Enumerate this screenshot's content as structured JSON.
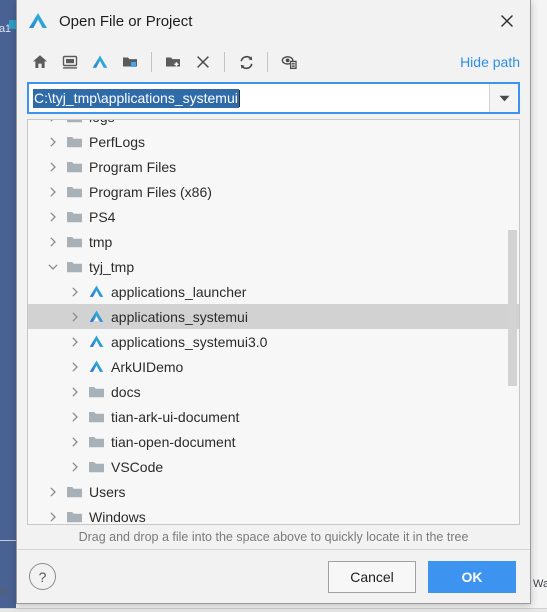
{
  "background": {
    "left_tab_label": "a1",
    "bottom_left_label": "W",
    "right_label": "Wa"
  },
  "dialog": {
    "title": "Open File or Project",
    "app_icon": "deveco-logo-icon",
    "close_label": "✕"
  },
  "toolbar": {
    "buttons": [
      {
        "name": "home-icon",
        "tooltip": "Home"
      },
      {
        "name": "desktop-icon",
        "tooltip": "Desktop"
      },
      {
        "name": "project-dir-icon",
        "tooltip": "Project Directory"
      },
      {
        "name": "recent-folder-icon",
        "tooltip": "Recent"
      },
      {
        "name": "new-folder-icon",
        "tooltip": "New Folder"
      },
      {
        "name": "delete-icon",
        "tooltip": "Delete"
      },
      {
        "name": "refresh-icon",
        "tooltip": "Refresh"
      },
      {
        "name": "show-hidden-icon",
        "tooltip": "Show Hidden Files"
      }
    ],
    "hide_path_label": "Hide path"
  },
  "path_field": {
    "value": "C:\\tyj_tmp\\applications_systemui",
    "placeholder": "",
    "selected": true,
    "dropdown_icon": "chevron-down-icon"
  },
  "tree": {
    "items": [
      {
        "label": "logs",
        "icon": "folder-icon",
        "indent": 1,
        "expanded": false,
        "selected": false,
        "partial": true
      },
      {
        "label": "PerfLogs",
        "icon": "folder-icon",
        "indent": 1,
        "expanded": false,
        "selected": false
      },
      {
        "label": "Program Files",
        "icon": "folder-icon",
        "indent": 1,
        "expanded": false,
        "selected": false
      },
      {
        "label": "Program Files (x86)",
        "icon": "folder-icon",
        "indent": 1,
        "expanded": false,
        "selected": false
      },
      {
        "label": "PS4",
        "icon": "folder-icon",
        "indent": 1,
        "expanded": false,
        "selected": false
      },
      {
        "label": "tmp",
        "icon": "folder-icon",
        "indent": 1,
        "expanded": false,
        "selected": false
      },
      {
        "label": "tyj_tmp",
        "icon": "folder-icon",
        "indent": 1,
        "expanded": true,
        "selected": false
      },
      {
        "label": "applications_launcher",
        "icon": "project-icon",
        "indent": 2,
        "expanded": false,
        "selected": false
      },
      {
        "label": "applications_systemui",
        "icon": "project-icon",
        "indent": 2,
        "expanded": false,
        "selected": true
      },
      {
        "label": "applications_systemui3.0",
        "icon": "project-icon",
        "indent": 2,
        "expanded": false,
        "selected": false
      },
      {
        "label": "ArkUIDemo",
        "icon": "project-icon",
        "indent": 2,
        "expanded": false,
        "selected": false
      },
      {
        "label": "docs",
        "icon": "folder-icon",
        "indent": 2,
        "expanded": false,
        "selected": false
      },
      {
        "label": "tian-ark-ui-document",
        "icon": "folder-icon",
        "indent": 2,
        "expanded": false,
        "selected": false
      },
      {
        "label": "tian-open-document",
        "icon": "folder-icon",
        "indent": 2,
        "expanded": false,
        "selected": false
      },
      {
        "label": "VSCode",
        "icon": "folder-icon",
        "indent": 2,
        "expanded": false,
        "selected": false
      },
      {
        "label": "Users",
        "icon": "folder-icon",
        "indent": 1,
        "expanded": false,
        "selected": false
      },
      {
        "label": "Windows",
        "icon": "folder-icon",
        "indent": 1,
        "expanded": false,
        "selected": false
      }
    ],
    "scrollbar": {
      "thumb_top_pct": 27,
      "thumb_height_pct": 39
    }
  },
  "hint": {
    "text": "Drag and drop a file into the space above to quickly locate it in the tree"
  },
  "footer": {
    "help_label": "?",
    "cancel_label": "Cancel",
    "ok_label": "OK"
  },
  "colors": {
    "accent": "#3c93f0",
    "link": "#2f8fe8",
    "selection_row": "#d2d2d2",
    "text_selection": "#2f6ba8",
    "folder": "#a8b0b8",
    "dialog_bg": "#f2f2f2"
  }
}
